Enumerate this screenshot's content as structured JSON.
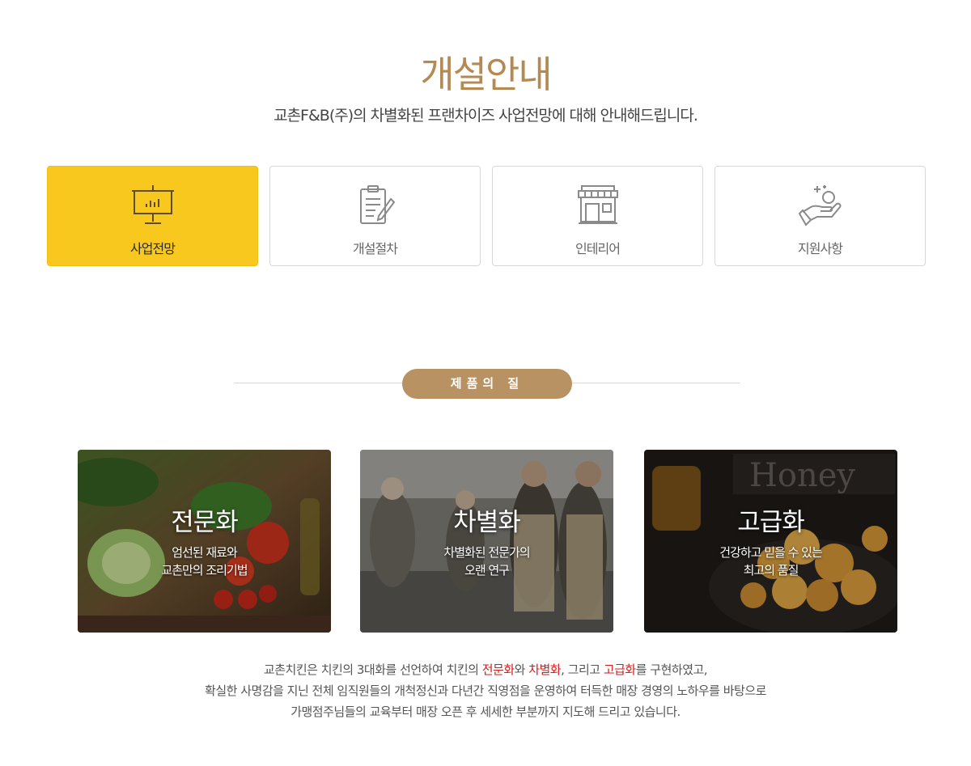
{
  "header": {
    "title": "개설안내",
    "subtitle": "교촌F&B(주)의 차별화된 프랜차이즈 사업전망에 대해 안내해드립니다."
  },
  "tabs": [
    {
      "label": "사업전망",
      "icon": "presentation-chart-icon",
      "active": true
    },
    {
      "label": "개설절차",
      "icon": "clipboard-pencil-icon",
      "active": false
    },
    {
      "label": "인테리어",
      "icon": "storefront-icon",
      "active": false
    },
    {
      "label": "지원사항",
      "icon": "hand-sparkle-icon",
      "active": false
    }
  ],
  "section": {
    "pill_label": "제품의 질"
  },
  "cards": [
    {
      "title": "전문화",
      "desc_line1": "엄선된 재료와",
      "desc_line2": "교촌만의 조리기법",
      "image": "vegetables-photo"
    },
    {
      "title": "차별화",
      "desc_line1": "차별화된 전문가의",
      "desc_line2": "오랜 연구",
      "image": "chefs-kitchen-photo"
    },
    {
      "title": "고급화",
      "desc_line1": "건강하고 믿을 수 있는",
      "desc_line2": "최고의 품질",
      "image": "honey-chicken-photo"
    }
  ],
  "body": {
    "line1_a": "교촌치킨은 치킨의 3대화를 선언하여 치킨의 ",
    "line1_hl1": "전문화",
    "line1_b": "와 ",
    "line1_hl2": "차별화",
    "line1_c": ", 그리고 ",
    "line1_hl3": "고급화",
    "line1_d": "를 구현하였고,",
    "line2": "확실한 사명감을 지닌 전체 임직원들의 개척정신과 다년간 직영점을 운영하여 터득한 매장 경영의 노하우를 바탕으로",
    "line3": "가맹점주님들의 교육부터 매장 오픈 후 세세한 부분까지 지도해 드리고 있습니다."
  },
  "colors": {
    "accent_gold": "#b48a52",
    "active_tab": "#f8c81e",
    "pill": "#b89262",
    "highlight_red": "#d61b1b"
  }
}
